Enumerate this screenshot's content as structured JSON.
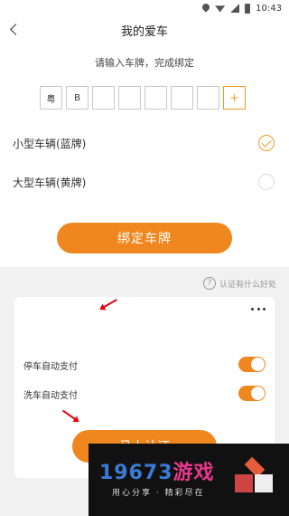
{
  "status_bar": {
    "time": "10:43"
  },
  "nav": {
    "title": "我的爱车"
  },
  "plate_entry": {
    "subtitle": "请输入车牌，完成绑定",
    "boxes": [
      "粤",
      "B",
      "",
      "",
      "",
      "",
      ""
    ],
    "add_label": "+"
  },
  "vehicle_types": [
    {
      "label": "小型车辆(蓝牌)",
      "selected": true
    },
    {
      "label": "大型车辆(黄牌)",
      "selected": false
    }
  ],
  "bind_button": {
    "label": "绑定车牌"
  },
  "help": {
    "icon": "?",
    "text": "认证有什么好处"
  },
  "card": {
    "more_label": "more-icon",
    "toggles": [
      {
        "label": "停车自动支付",
        "on": true
      },
      {
        "label": "洗车自动支付",
        "on": true
      }
    ],
    "auth_button": {
      "label": "马上认证"
    }
  },
  "watermark": {
    "main": "19673",
    "main_highlight": "游戏",
    "sub": "用心分享 · 精彩尽在"
  },
  "colors": {
    "accent": "#f0871e",
    "arrow": "#e60012"
  }
}
